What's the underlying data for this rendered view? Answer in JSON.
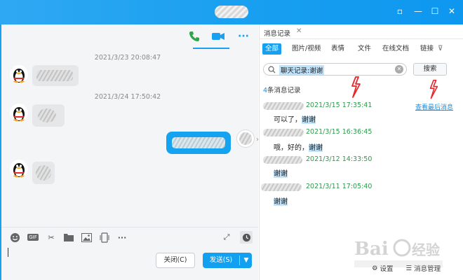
{
  "window": {
    "title_blurred": true,
    "controls": [
      "minimize",
      "restore",
      "maximize",
      "close"
    ]
  },
  "chat": {
    "toolbar_icons": [
      "phone-call-icon",
      "video-call-icon",
      "more-icon"
    ],
    "messages": [
      {
        "time": "2021/3/23 20:08:47",
        "side": "left",
        "blurred": true
      },
      {
        "time": "2021/3/24 17:50:42",
        "side": "left",
        "blurred": true
      },
      {
        "side": "right",
        "blurred": true
      },
      {
        "side": "left",
        "blurred": true
      }
    ],
    "input_tools": [
      "emoji-icon",
      "gif-icon",
      "scissors-icon",
      "folder-icon",
      "image-icon",
      "phone-screen-icon",
      "more-icon"
    ],
    "input_tools_labels": {
      "gif": "GIF",
      "more": "···"
    },
    "close_label": "关闭(C)",
    "send_label": "发送(S)"
  },
  "history": {
    "tab_label": "消息记录",
    "filter_tabs": [
      "全部",
      "图片/视频",
      "表情",
      "文件",
      "在线文档",
      "链接"
    ],
    "active_filter": "全部",
    "search_value": "聊天记录:谢谢",
    "search_button": "搜索",
    "count_number": "4",
    "count_text": "条消息记录",
    "view_latest": "查看最后消息",
    "records": [
      {
        "time": "2021/3/15 17:35:41",
        "text_pre": "可以了，",
        "text_hl": "谢谢"
      },
      {
        "time": "2021/3/15 16:36:45",
        "text_pre": "哦，好的，",
        "text_hl": "谢谢"
      },
      {
        "time": "2021/3/12 14:33:50",
        "text_pre": "",
        "text_hl": "谢谢"
      },
      {
        "time": "2021/3/11 17:05:40",
        "text_pre": "",
        "text_hl": "谢谢"
      }
    ],
    "bottom": {
      "settings": "设置",
      "manage": "消息管理"
    }
  },
  "watermark": "Bai 经验",
  "colors": {
    "accent": "#1aa0f0",
    "time_green": "#2a9a4a",
    "annotation_red": "#e8262b"
  }
}
